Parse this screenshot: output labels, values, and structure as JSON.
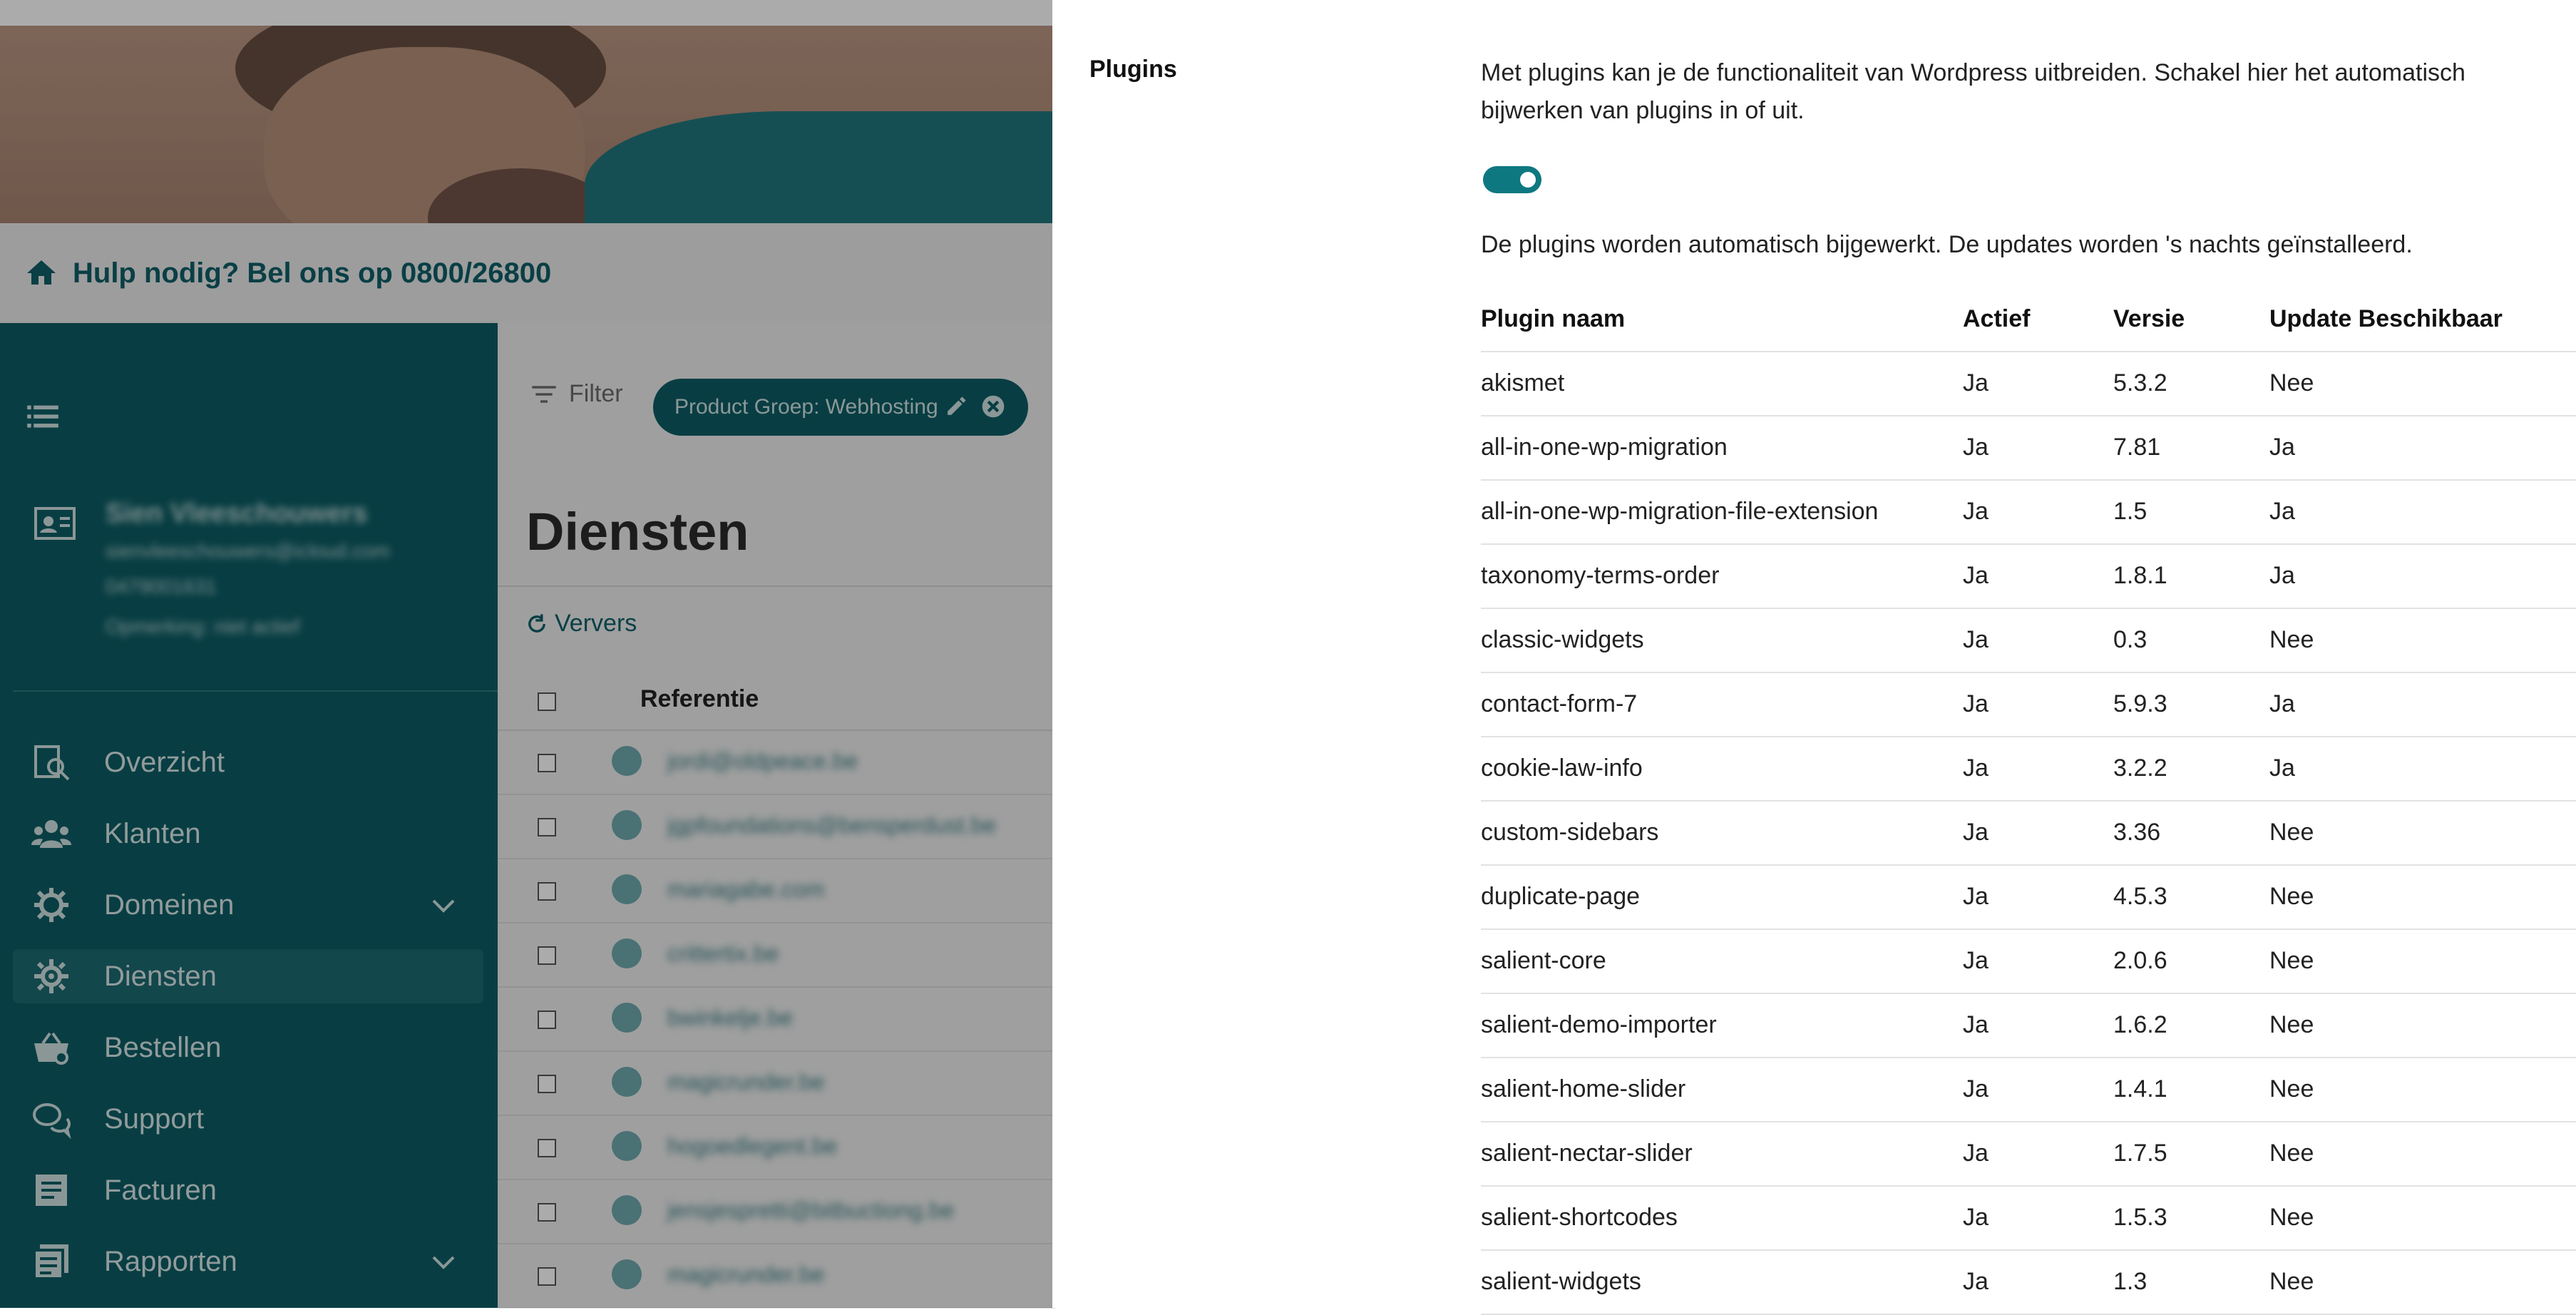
{
  "app": {
    "help_text": "Hulp nodig? Bel ons op 0800/26800",
    "accent_color": "#0c5d64"
  },
  "sidebar": {
    "profile": {
      "name": "Sien Vleeschouwers",
      "email": "sienvleeschouwers@icloud.com",
      "phone": "0479001631",
      "note": "Opmerking: niet actief"
    },
    "items": [
      {
        "label": "Overzicht",
        "icon": "search-document-icon"
      },
      {
        "label": "Klanten",
        "icon": "users-icon"
      },
      {
        "label": "Domeinen",
        "icon": "gear-icon"
      },
      {
        "label": "Diensten",
        "icon": "gear-cog-icon"
      },
      {
        "label": "Bestellen",
        "icon": "basket-icon"
      },
      {
        "label": "Support",
        "icon": "chat-icon"
      },
      {
        "label": "Facturen",
        "icon": "invoice-icon"
      },
      {
        "label": "Rapporten",
        "icon": "report-icon"
      }
    ]
  },
  "main": {
    "filter_label": "Filter",
    "chip_label": "Product Groep: Webhosting",
    "page_title": "Diensten",
    "refresh_label": "Ververs",
    "column_reference": "Referentie",
    "rows": [
      "jordi@oldpeace.be",
      "jgpfoundations@bensperdust.be",
      "mariagabe.com",
      "crittertix.be",
      "bwinkelje.be",
      "magicrunder.be",
      "hogoedlegent.be",
      "jensjespretti@bitbuctiong.be",
      "magicrunder.be"
    ]
  },
  "panel": {
    "section_title": "Plugins",
    "description": "Met plugins kan je de functionaliteit van Wordpress uitbreiden. Schakel hier het automatisch bijwerken van plugins in of uit.",
    "auto_update_enabled": true,
    "status_text": "De plugins worden automatisch bijgewerkt. De updates worden 's nachts geïnstalleerd.",
    "columns": [
      "Plugin naam",
      "Actief",
      "Versie",
      "Update Beschikbaar"
    ],
    "plugins": [
      {
        "name": "akismet",
        "active": "Ja",
        "version": "5.3.2",
        "update": "Nee"
      },
      {
        "name": "all-in-one-wp-migration",
        "active": "Ja",
        "version": "7.81",
        "update": "Ja"
      },
      {
        "name": "all-in-one-wp-migration-file-extension",
        "active": "Ja",
        "version": "1.5",
        "update": "Ja"
      },
      {
        "name": "taxonomy-terms-order",
        "active": "Ja",
        "version": "1.8.1",
        "update": "Ja"
      },
      {
        "name": "classic-widgets",
        "active": "Ja",
        "version": "0.3",
        "update": "Nee"
      },
      {
        "name": "contact-form-7",
        "active": "Ja",
        "version": "5.9.3",
        "update": "Ja"
      },
      {
        "name": "cookie-law-info",
        "active": "Ja",
        "version": "3.2.2",
        "update": "Ja"
      },
      {
        "name": "custom-sidebars",
        "active": "Ja",
        "version": "3.36",
        "update": "Nee"
      },
      {
        "name": "duplicate-page",
        "active": "Ja",
        "version": "4.5.3",
        "update": "Nee"
      },
      {
        "name": "salient-core",
        "active": "Ja",
        "version": "2.0.6",
        "update": "Nee"
      },
      {
        "name": "salient-demo-importer",
        "active": "Ja",
        "version": "1.6.2",
        "update": "Nee"
      },
      {
        "name": "salient-home-slider",
        "active": "Ja",
        "version": "1.4.1",
        "update": "Nee"
      },
      {
        "name": "salient-nectar-slider",
        "active": "Ja",
        "version": "1.7.5",
        "update": "Nee"
      },
      {
        "name": "salient-shortcodes",
        "active": "Ja",
        "version": "1.5.3",
        "update": "Nee"
      },
      {
        "name": "salient-widgets",
        "active": "Ja",
        "version": "1.3",
        "update": "Nee"
      }
    ]
  }
}
